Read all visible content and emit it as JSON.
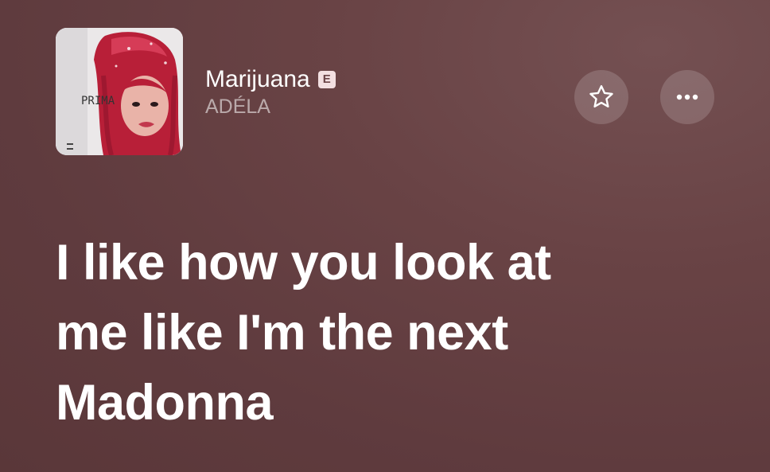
{
  "now_playing": {
    "title": "Marijuana",
    "explicit_label": "E",
    "artist": "ADÉLA",
    "artwork_text": "PRIMA"
  },
  "actions": {
    "favorite_icon": "star-outline-icon",
    "more_icon": "ellipsis-icon"
  },
  "lyrics": {
    "previous_line": "",
    "current_lines": [
      "I like how you look at",
      "me like I'm the next",
      "Madonna"
    ]
  },
  "colors": {
    "background": "#653f42",
    "text": "#ffffff",
    "secondary_text": "#c5aeb0",
    "explicit_badge_bg": "#f3dfe1"
  }
}
